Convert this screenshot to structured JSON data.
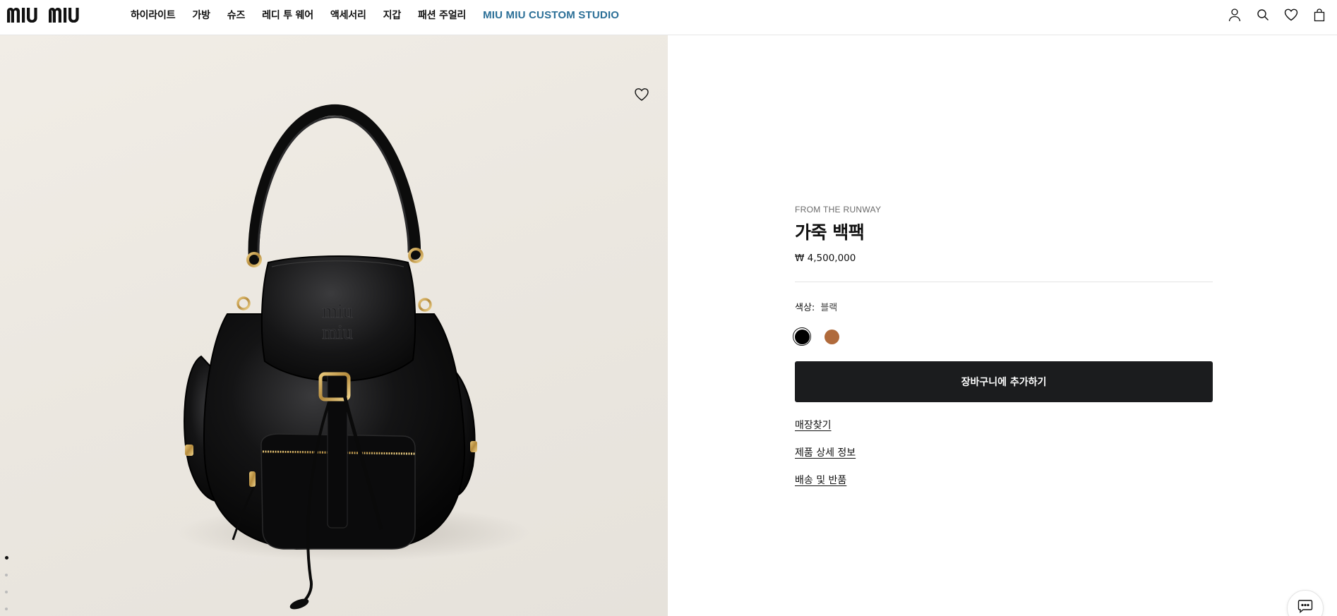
{
  "header": {
    "logo_text": "MIU MIU",
    "nav": [
      {
        "label": "하이라이트"
      },
      {
        "label": "가방"
      },
      {
        "label": "슈즈"
      },
      {
        "label": "레디 투 웨어"
      },
      {
        "label": "액세서리"
      },
      {
        "label": "지갑"
      },
      {
        "label": "패션 주얼리"
      },
      {
        "label": "MIU MIU CUSTOM STUDIO",
        "accent": "#2b6f97"
      }
    ],
    "icons": [
      "account-icon",
      "search-icon",
      "wishlist-icon",
      "bag-icon"
    ]
  },
  "gallery": {
    "image_alt": "Black leather backpack",
    "image_count": 5,
    "active_index": 0,
    "wishlist_icon": "heart-icon"
  },
  "product": {
    "eyebrow": "FROM THE RUNWAY",
    "title": "가죽 백팩",
    "price": "₩ 4,500,000",
    "color_label": "색상:",
    "color_value": "블랙",
    "swatches": [
      {
        "name": "블랙",
        "color": "#000000",
        "selected": true
      },
      {
        "name": "브라운",
        "color": "#b06a3b",
        "selected": false
      }
    ],
    "add_to_cart": "장바구니에 추가하기",
    "links": [
      "매장찾기",
      "제품 상세 정보",
      "배송 및 반품"
    ]
  },
  "colors": {
    "button_bg": "#1b1c1e",
    "image_bg": "#ece8e1"
  }
}
